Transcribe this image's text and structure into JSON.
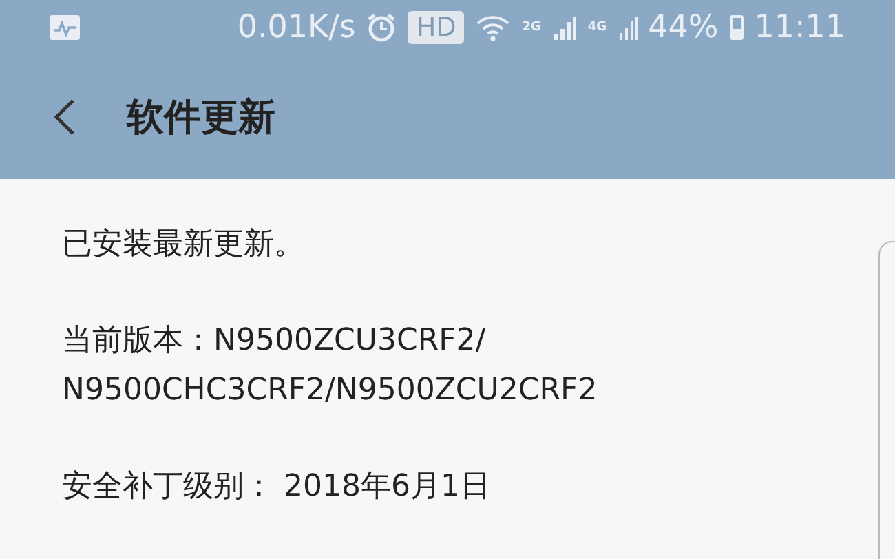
{
  "status_bar": {
    "net_speed": "0.01K/s",
    "hd_badge": "HD",
    "sim1_label": "2G",
    "sim2_label": "4G",
    "battery": "44%",
    "time": "11:11"
  },
  "header": {
    "title": "软件更新"
  },
  "content": {
    "paragraphs": [
      "已安装最新更新。",
      "当前版本：N9500ZCU3CRF2/\nN9500CHC3CRF2/N9500ZCU2CRF2",
      "安全补丁级别： 2018年6月1日"
    ]
  }
}
